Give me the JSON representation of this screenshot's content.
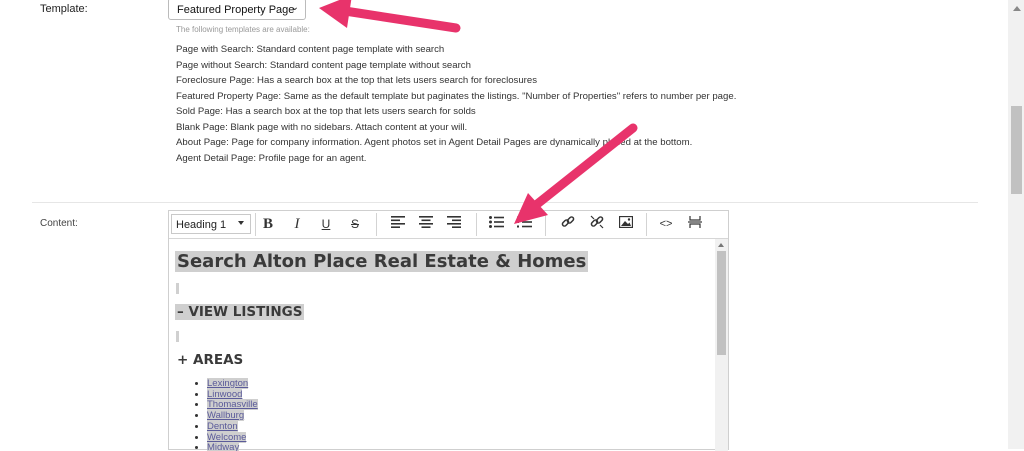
{
  "template": {
    "label": "Template:",
    "selected": "Featured Property Page",
    "help_text": "The following templates are available:",
    "descriptions": [
      "Page with Search: Standard content page template with search",
      "Page without Search: Standard content page template without search",
      "Foreclosure Page: Has a search box at the top that lets users search for foreclosures",
      "Featured Property Page: Same as the default template but paginates the listings. \"Number of Properties\" refers to number per page.",
      "Sold Page: Has a search box at the top that lets users search for solds",
      "Blank Page: Blank page with no sidebars. Attach content at your will.",
      "About Page: Page for company information. Agent photos set in Agent Detail Pages are dynamically placed at the bottom.",
      "Agent Detail Page: Profile page for an agent."
    ]
  },
  "content": {
    "label": "Content:",
    "toolbar": {
      "block_format": "Heading 1",
      "bold": "B",
      "italic": "I",
      "underline": "U",
      "strike": "S",
      "code": "<>"
    },
    "doc": {
      "heading": "Search Alton Place Real Estate & Homes",
      "view_listings": "– VIEW LISTINGS",
      "areas": "+ AREAS",
      "area_links": [
        "Lexington",
        "Linwood",
        "Thomasville",
        "Wallburg",
        "Denton",
        "Welcome",
        "Midway"
      ]
    }
  },
  "colors": {
    "annotation_arrow": "#e8336b",
    "highlight": "#cfcfcf"
  }
}
